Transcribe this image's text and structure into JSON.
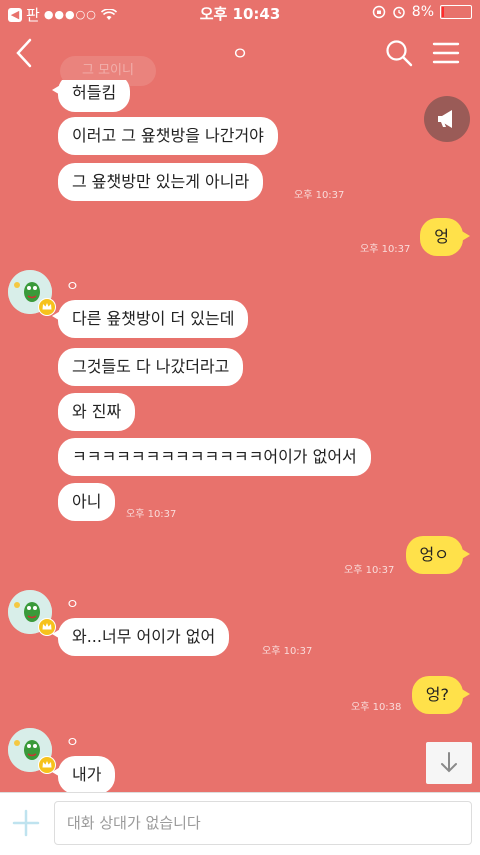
{
  "status": {
    "back_app": "판",
    "carrier_signal": "●●●○○",
    "time": "오후 10:43",
    "battery": "8%"
  },
  "header": {
    "title": "ㅇ",
    "ghost_text": "그 모이니"
  },
  "messages": {
    "m1": "허들킴",
    "m2": "이러고 그 욮챗방을 나간거야",
    "m3": "그 욮챗방만 있는게 아니라",
    "t1": "오후 10:37",
    "m4": "엉",
    "t2": "오후 10:37",
    "s1": "ㅇ",
    "m5": "다른 욮챗방이 더 있는데",
    "m6": "그것들도 다 나갔더라고",
    "m7": "와 진짜",
    "m8": "ㅋㅋㅋㅋㅋㅋㅋㅋㅋㅋㅋㅋㅋ어이가 없어서",
    "m9": "아니",
    "t3": "오후 10:37",
    "m10": "엉ㅇ",
    "t4": "오후 10:37",
    "s2": "ㅇ",
    "m11": "와...너무 어이가 없어",
    "t5": "오후 10:37",
    "m12": "엉?",
    "t6": "오후 10:38",
    "s3": "ㅇ",
    "m13": "내가"
  },
  "input": {
    "placeholder": "대화 상대가 없습니다"
  },
  "colors": {
    "background": "#e8726c",
    "my_bubble": "#ffe14a",
    "other_bubble": "#ffffff"
  }
}
